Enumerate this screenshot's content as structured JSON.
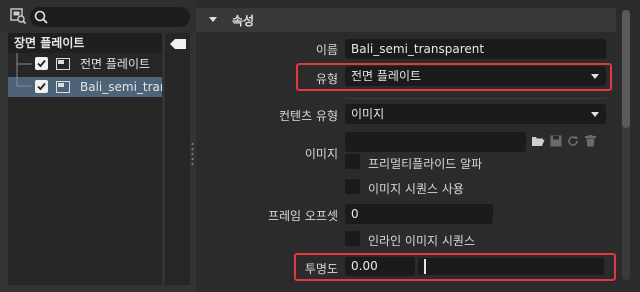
{
  "tree": {
    "header": "장면 플레이트",
    "items": [
      {
        "label": "전면 플레이트",
        "checked": true,
        "selected": false
      },
      {
        "label": "Bali_semi_trans",
        "checked": true,
        "selected": true
      }
    ]
  },
  "properties": {
    "section_title": "속성",
    "name_label": "이름",
    "name_value": "Bali_semi_transparent",
    "type_label": "유형",
    "type_value": "전면 플레이트",
    "content_type_label": "컨텐츠 유형",
    "content_type_value": "이미지",
    "image_label": "이미지",
    "image_value": "",
    "premultiplied_alpha_label": "프리멀티플라이드 알파",
    "image_sequence_label": "이미지 시퀀스 사용",
    "frame_offset_label": "프레임 오프셋",
    "frame_offset_value": "0",
    "inline_sequence_label": "인라인 이미지 시퀀스",
    "opacity_label": "투명도",
    "opacity_value": "0.00",
    "opacity_fraction": 0.0
  },
  "colors": {
    "highlight": "#e0383e",
    "selection": "#4d6478"
  }
}
